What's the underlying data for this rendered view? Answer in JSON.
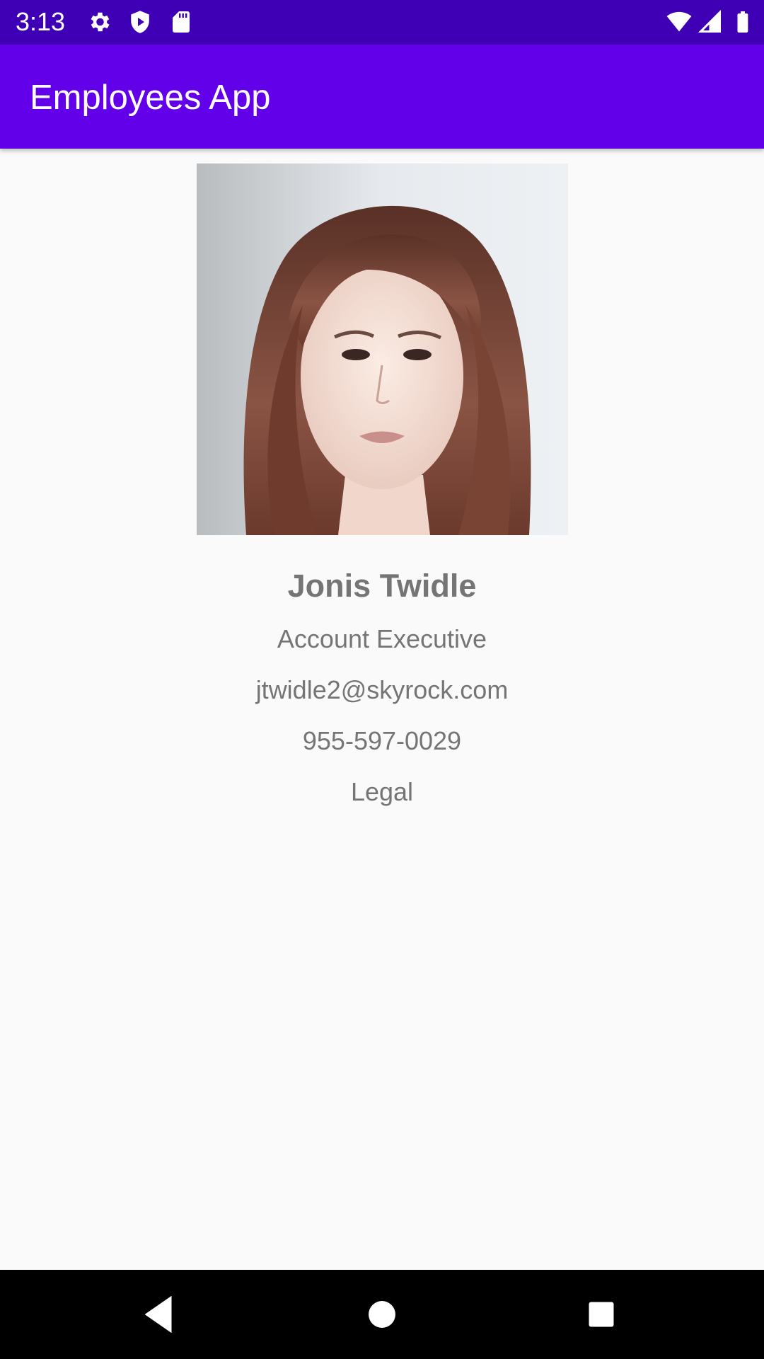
{
  "status_bar": {
    "time": "3:13",
    "left_icons": [
      "gear-icon",
      "shield-play-icon",
      "sd-card-icon"
    ],
    "right_icons": [
      "wifi-icon",
      "cell-signal-icon",
      "battery-icon"
    ]
  },
  "app_bar": {
    "title": "Employees App",
    "color": "#6200ea"
  },
  "employee": {
    "photo_icon": "employee-photo",
    "name": "Jonis Twidle",
    "job_title": "Account Executive",
    "email": "jtwidle2@skyrock.com",
    "phone": "955-597-0029",
    "department": "Legal"
  },
  "nav_bar": {
    "buttons": [
      "back-icon",
      "home-icon",
      "recents-icon"
    ]
  }
}
